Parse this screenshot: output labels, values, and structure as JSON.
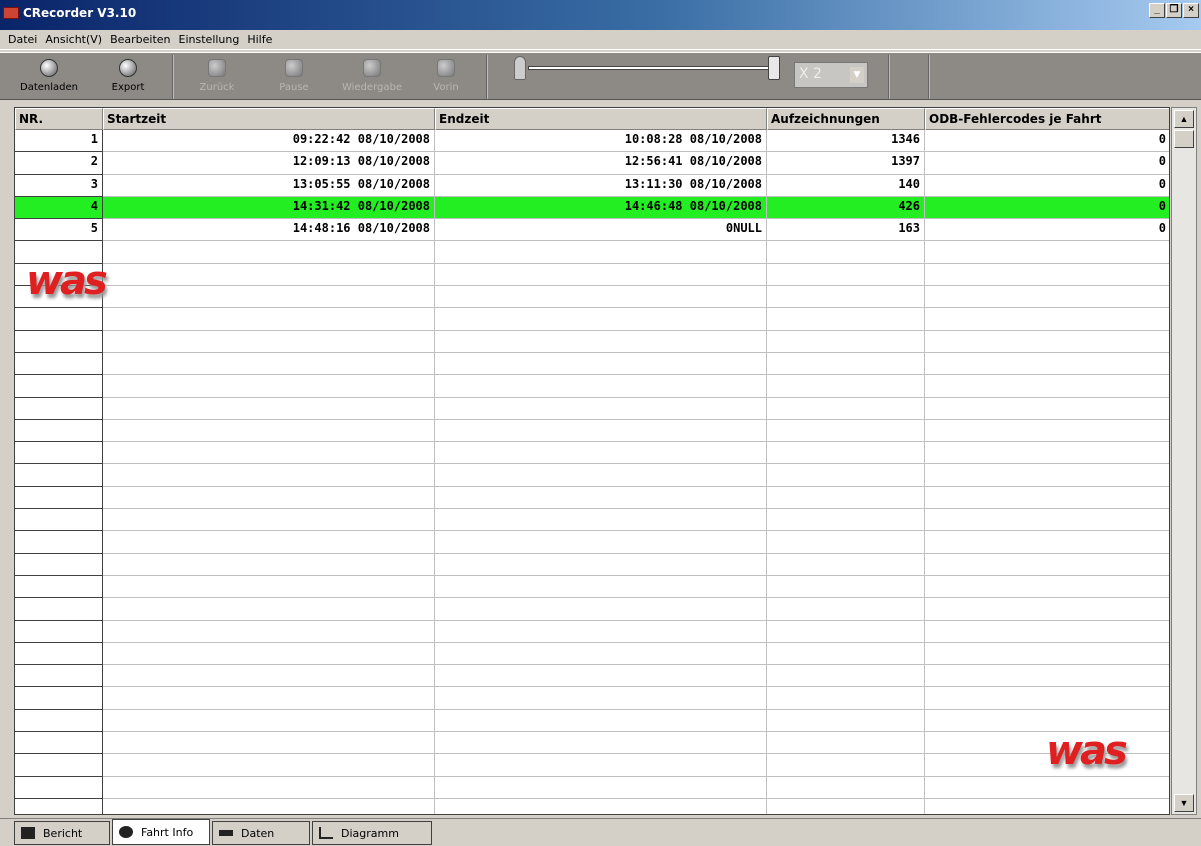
{
  "window": {
    "title": "CRecorder V3.10",
    "min": "_",
    "restore": "❐",
    "close": "×"
  },
  "menu": [
    "Datei",
    "Ansicht(V)",
    "Bearbeiten",
    "Einstellung",
    "Hilfe"
  ],
  "toolbar": {
    "buttons": [
      {
        "label": "Datenladen",
        "icon": "load-icon",
        "enabled": true
      },
      {
        "label": "Export",
        "icon": "export-icon",
        "enabled": true
      },
      {
        "label": "Zurück",
        "icon": "back-icon",
        "enabled": false
      },
      {
        "label": "Pause",
        "icon": "pause-icon",
        "enabled": false
      },
      {
        "label": "Wiedergabe",
        "icon": "play-icon",
        "enabled": false
      },
      {
        "label": "Vorin",
        "icon": "forward-icon",
        "enabled": false
      }
    ],
    "speed": "X 2"
  },
  "grid": {
    "columns": [
      "NR.",
      "Startzeit",
      "Endzeit",
      "Aufzeichnungen",
      "ODB-Fehlercodes je Fahrt"
    ],
    "rows": [
      {
        "nr": "1",
        "start": "09:22:42 08/10/2008",
        "end": "10:08:28 08/10/2008",
        "records": "1346",
        "errors": "0"
      },
      {
        "nr": "2",
        "start": "12:09:13 08/10/2008",
        "end": "12:56:41 08/10/2008",
        "records": "1397",
        "errors": "0"
      },
      {
        "nr": "3",
        "start": "13:05:55 08/10/2008",
        "end": "13:11:30 08/10/2008",
        "records": "140",
        "errors": "0"
      },
      {
        "nr": "4",
        "start": "14:31:42 08/10/2008",
        "end": "14:46:48 08/10/2008",
        "records": "426",
        "errors": "0"
      },
      {
        "nr": "5",
        "start": "14:48:16 08/10/2008",
        "end": "0NULL",
        "records": "163",
        "errors": "0"
      }
    ],
    "selected_row": 3,
    "highlight_color": "#22ee22"
  },
  "logo": "was",
  "tabs": [
    {
      "label": "Bericht",
      "icon": "report-icon"
    },
    {
      "label": "Fahrt Info",
      "icon": "gear-icon",
      "active": true
    },
    {
      "label": "Daten",
      "icon": "data-icon"
    },
    {
      "label": "Diagramm",
      "icon": "chart-icon"
    }
  ]
}
